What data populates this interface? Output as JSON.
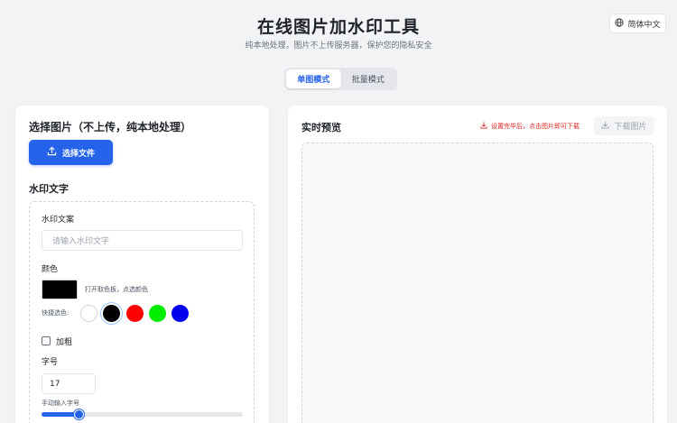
{
  "header": {
    "title": "在线图片加水印工具",
    "subtitle": "纯本地处理，图片不上传服务器，保护您的隐私安全",
    "language": "简体中文",
    "language_icon": "globe-icon"
  },
  "tabs": [
    {
      "label": "单图模式",
      "active": true
    },
    {
      "label": "批量模式",
      "active": false
    }
  ],
  "left_panel": {
    "select_heading": "选择图片（不上传，纯本地处理）",
    "choose_button": "选择文件",
    "choose_icon": "upload-icon",
    "watermark_heading": "水印文字",
    "text_label": "水印文案",
    "text_placeholder": "请输入水印文字",
    "text_value": "",
    "color_label": "颜色",
    "color_value": "#000000",
    "color_hint": "打开取色板，点选颜色",
    "quick_color_label": "快捷选色:",
    "quick_colors": [
      "#ffffff",
      "#000000",
      "#ff0000",
      "#00ee00",
      "#0000ee"
    ],
    "selected_quick_color": "#000000",
    "bold_label": "加粗",
    "bold_checked": false,
    "size_label": "字号",
    "size_value": "17",
    "size_hint": "手动输入字号",
    "size_slider_fraction": 0.17
  },
  "right_panel": {
    "preview_heading": "实时预览",
    "tip": "设置完毕后，点击图片即可下载",
    "tip_icon": "download-icon",
    "download_button": "下载图片",
    "download_enabled": false,
    "accent_color": "#2563eb",
    "tip_color": "#dc2626"
  }
}
